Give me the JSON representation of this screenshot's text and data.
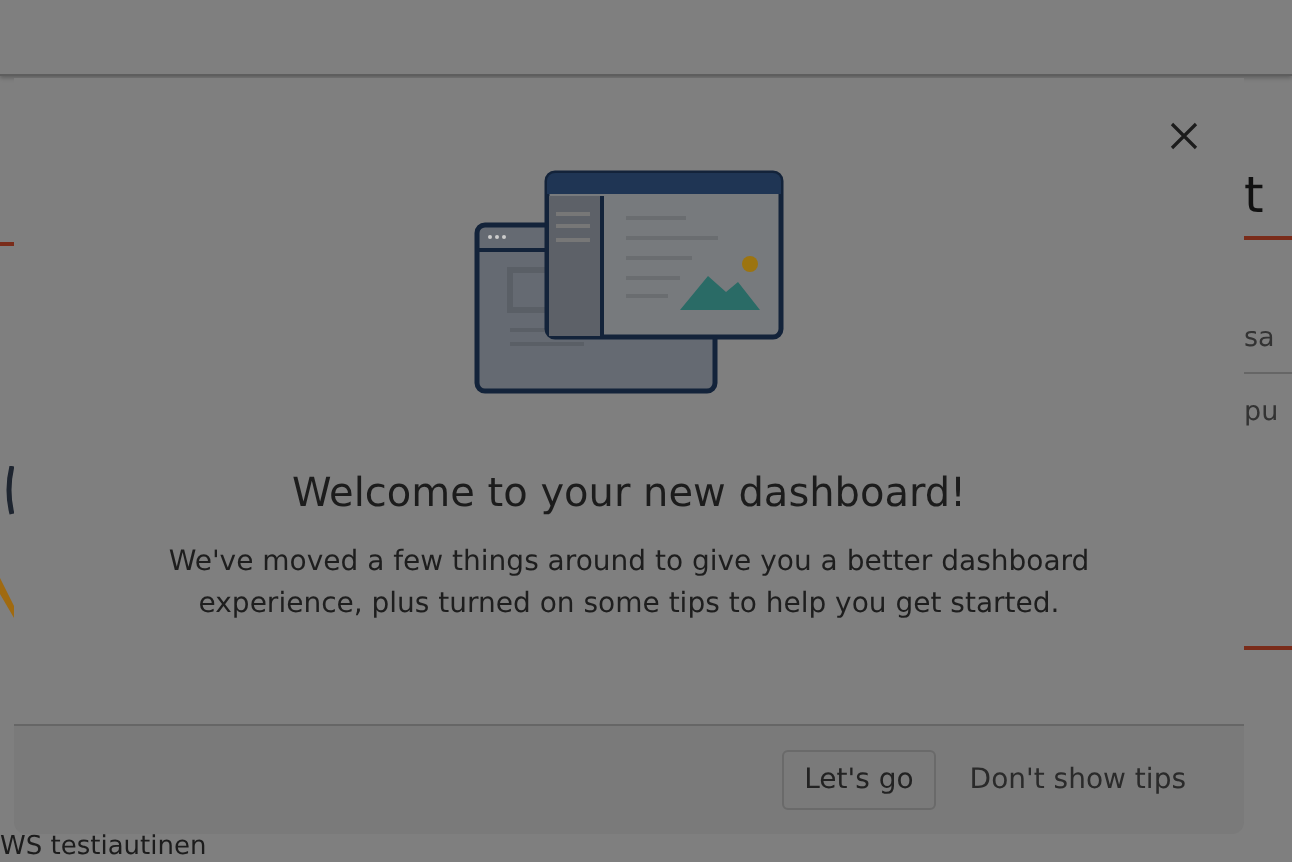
{
  "background": {
    "right_heading": "t",
    "right_items": [
      "sa",
      "pu"
    ],
    "bottom_text": "WS testiautinen"
  },
  "dialog": {
    "title": "Welcome to your new dashboard!",
    "message": "We've moved a few things around to give you a better dashboard experience, plus turned on some tips to help you get started.",
    "buttons": [
      {
        "label": "Let's go",
        "kind": "outlined"
      },
      {
        "label": "Don't show tips",
        "kind": "plain"
      }
    ]
  }
}
